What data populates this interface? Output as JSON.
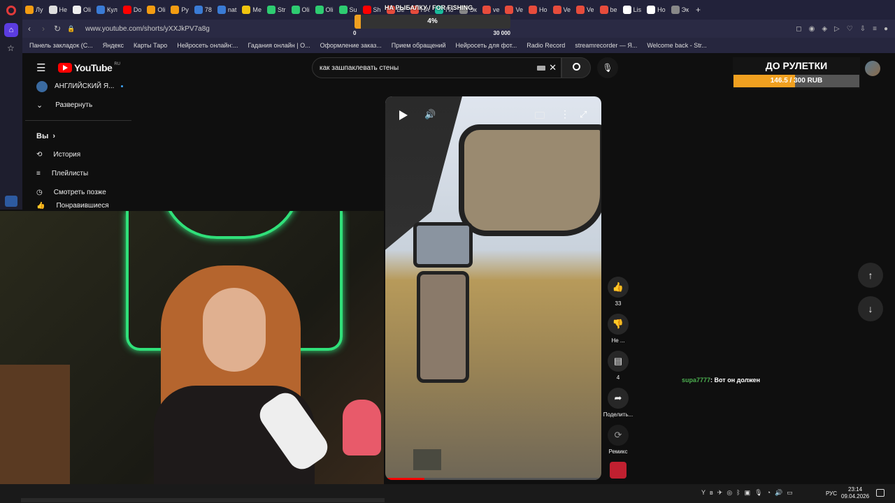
{
  "browser": {
    "url": "www.youtube.com/shorts/yXXJkPV7a8g",
    "tabs": [
      "Лу",
      "Не",
      "Oli",
      "Кул",
      "Do",
      "Oli",
      "Py",
      "78",
      "nat",
      "Ме",
      "Str",
      "Oli",
      "Oli",
      "Su",
      "Sh",
      "Be",
      "НА",
      "По",
      "Эк",
      "ve",
      "Ve",
      "Но",
      "Ve",
      "Ve",
      "be",
      "Lis",
      "Но",
      "Эк"
    ],
    "bookmarks": [
      "Панель закладок (С...",
      "Яндекс",
      "Карты Таро",
      "Нейросеть онлайн:...",
      "Гадания онлайн | О...",
      "Оформление заказ...",
      "Прием обращений",
      "Нейросеть для фот...",
      "Radio Record",
      "streamrecorder — Я...",
      "Welcome back - Str..."
    ]
  },
  "overlay": {
    "title": "НА РЫБАЛКУ / FOR FISHING",
    "progress_label": "4%",
    "progress": 0.04,
    "min": "0",
    "max": "30 000"
  },
  "youtube": {
    "logo": "YouTube",
    "region": "RU",
    "search_value": "как зашпаклевать стены",
    "sidebar": {
      "channel": "АНГЛИЙСКИЙ Я...",
      "expand": "Развернуть",
      "you": "Вы",
      "items": [
        "История",
        "Плейлисты",
        "Смотреть позже",
        "Понравившиеся"
      ]
    },
    "actions": {
      "likes": "33",
      "dislike": "Не ...",
      "comments": "4",
      "share": "Поделить...",
      "remix": "Ремикс"
    }
  },
  "roulette": {
    "title": "ДО РУЛЕТКИ",
    "progress_text": "146.5 / 300 RUB",
    "progress": 0.488
  },
  "chat": {
    "user": "supa7777",
    "message": ": Вот он должен"
  },
  "taskbar": {
    "time": "23:14",
    "date": "09.04.2026",
    "lang": "РУС"
  }
}
